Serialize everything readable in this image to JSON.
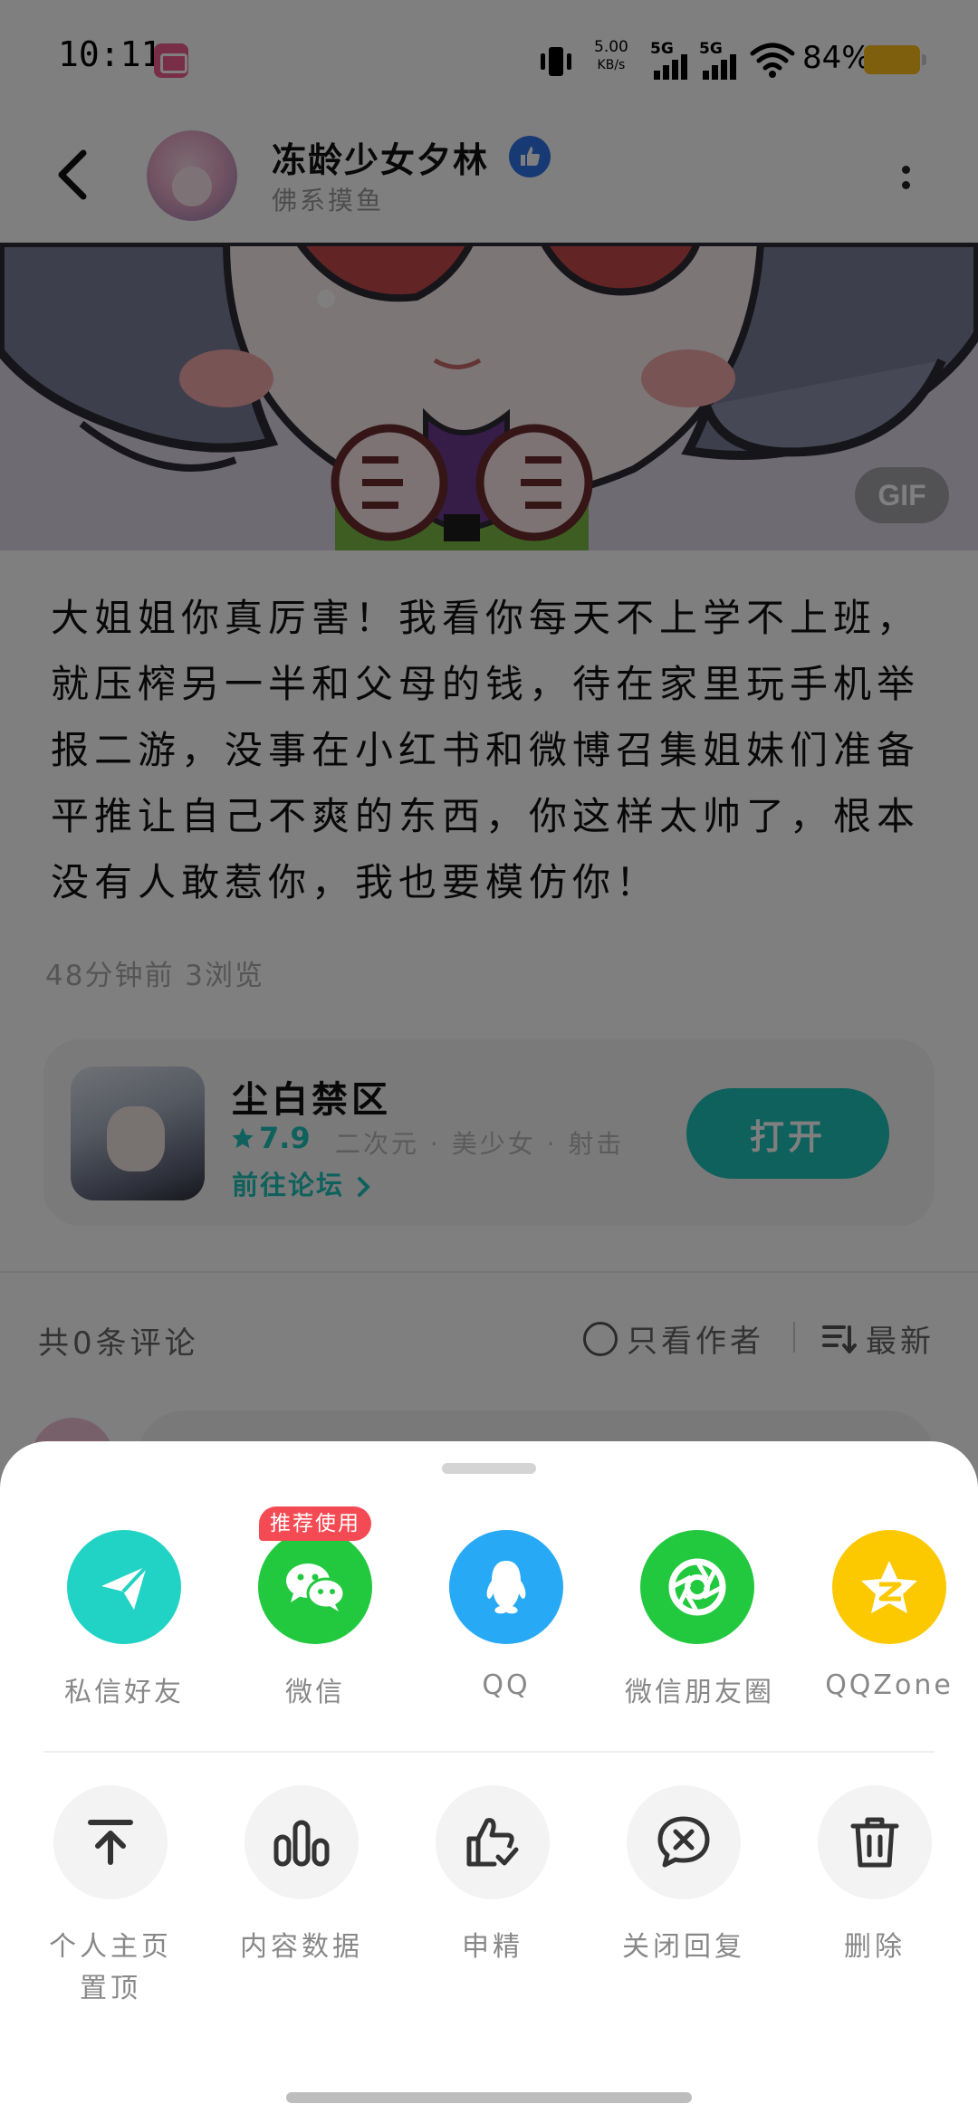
{
  "status_bar": {
    "time": "10:11",
    "speed_value": "5.00",
    "speed_unit": "KB/s",
    "signal_1": "5G",
    "signal_2": "5G",
    "battery": "84%"
  },
  "header": {
    "user_name": "冻龄少女夕林",
    "user_subtitle": "佛系摸鱼"
  },
  "post": {
    "gif_badge": "GIF",
    "text": "大姐姐你真厉害！我看你每天不上学不上班，就压榨另一半和父母的钱，待在家里玩手机举报二游，没事在小红书和微博召集姐妹们准备平推让自己不爽的东西，你这样太帅了，根本没有人敢惹你，我也要模仿你！",
    "meta": "48分钟前 3浏览"
  },
  "game_card": {
    "name": "尘白禁区",
    "rating": "7.9",
    "tags": "二次元 · 美少女 · 射击",
    "forum_link": "前往论坛",
    "open_label": "打开"
  },
  "comments": {
    "count_label": "共0条评论",
    "only_author_label": "只看作者",
    "sort_label": "最新"
  },
  "share_sheet": {
    "recommend_badge": "推荐使用",
    "targets": [
      {
        "label": "私信好友",
        "icon": "paper-plane-icon",
        "color": "#21d3c4"
      },
      {
        "label": "微信",
        "icon": "wechat-icon",
        "color": "#22c93f"
      },
      {
        "label": "QQ",
        "icon": "qq-penguin-icon",
        "color": "#27a9f5"
      },
      {
        "label": "微信朋友圈",
        "icon": "moments-shutter-icon",
        "color": "#22c93f"
      },
      {
        "label": "QQZone",
        "icon": "qzone-star-icon",
        "color": "#fcc800"
      }
    ],
    "actions": [
      {
        "label": "个人主页置顶",
        "icon": "pin-top-icon"
      },
      {
        "label": "内容数据",
        "icon": "bar-chart-icon"
      },
      {
        "label": "申精",
        "icon": "thumbs-up-check-icon"
      },
      {
        "label": "关闭回复",
        "icon": "close-comment-icon"
      },
      {
        "label": "删除",
        "icon": "trash-icon"
      }
    ]
  }
}
